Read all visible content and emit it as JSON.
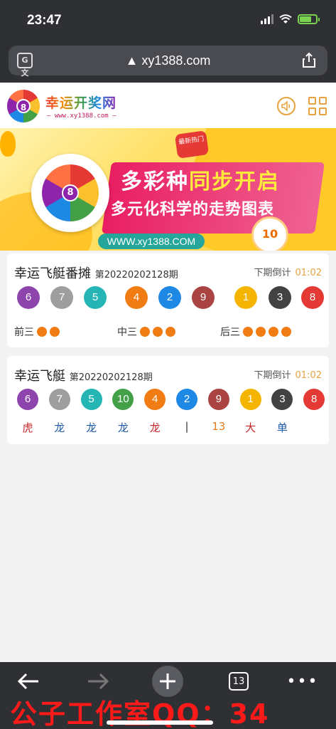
{
  "status_bar": {
    "time": "23:47"
  },
  "browser": {
    "url": "▲ xy1388.com",
    "translate_glyph": "G文",
    "tab_count": "13"
  },
  "site": {
    "name": "幸运开奖网",
    "url_text": "— www.xy1388.com —",
    "logo_number": "8"
  },
  "banner": {
    "line1_a": "多彩种",
    "line1_b": "同步开启",
    "line2": "多元化科学的走势图表",
    "web_url": "WWW.xy1388.COM",
    "badge_number": "10",
    "badge_new": "最新热门"
  },
  "card1": {
    "title": "幸运飞艇番摊",
    "period": "第20220202128期",
    "countdown_label": "下期倒计",
    "countdown_time": "01:02",
    "balls": [
      {
        "n": "6",
        "color": "#8e44ad"
      },
      {
        "n": "7",
        "color": "#9e9e9e"
      },
      {
        "n": "5",
        "color": "#26b5b5"
      },
      {
        "n": "4",
        "color": "#f07c13"
      },
      {
        "n": "2",
        "color": "#1e88e5"
      },
      {
        "n": "9",
        "color": "#a94442"
      },
      {
        "n": "1",
        "color": "#f5b400"
      },
      {
        "n": "3",
        "color": "#424242"
      },
      {
        "n": "8",
        "color": "#e53935"
      }
    ],
    "groups": [
      {
        "label": "前三",
        "dots": 2
      },
      {
        "label": "中三",
        "dots": 3
      },
      {
        "label": "后三",
        "dots": 4
      }
    ]
  },
  "card2": {
    "title": "幸运飞艇",
    "period": "第20220202128期",
    "countdown_label": "下期倒计",
    "countdown_time": "01:02",
    "balls": [
      {
        "n": "6",
        "color": "#8e44ad"
      },
      {
        "n": "7",
        "color": "#9e9e9e"
      },
      {
        "n": "5",
        "color": "#26b5b5"
      },
      {
        "n": "10",
        "color": "#43a047"
      },
      {
        "n": "4",
        "color": "#f07c13"
      },
      {
        "n": "2",
        "color": "#1e88e5"
      },
      {
        "n": "9",
        "color": "#a94442"
      },
      {
        "n": "1",
        "color": "#f5b400"
      },
      {
        "n": "3",
        "color": "#424242"
      },
      {
        "n": "8",
        "color": "#e53935"
      }
    ],
    "tags": [
      {
        "t": "虎",
        "color": "#c62828"
      },
      {
        "t": "龙",
        "color": "#1e5aa8"
      },
      {
        "t": "龙",
        "color": "#1e5aa8"
      },
      {
        "t": "龙",
        "color": "#1e5aa8"
      },
      {
        "t": "龙",
        "color": "#c62828"
      },
      {
        "t": "|",
        "color": "#333333"
      },
      {
        "t": "13",
        "color": "#e67e22"
      },
      {
        "t": "大",
        "color": "#c62828"
      },
      {
        "t": "单",
        "color": "#1e5aa8"
      }
    ]
  },
  "watermark": "公子工作室QQ：34"
}
